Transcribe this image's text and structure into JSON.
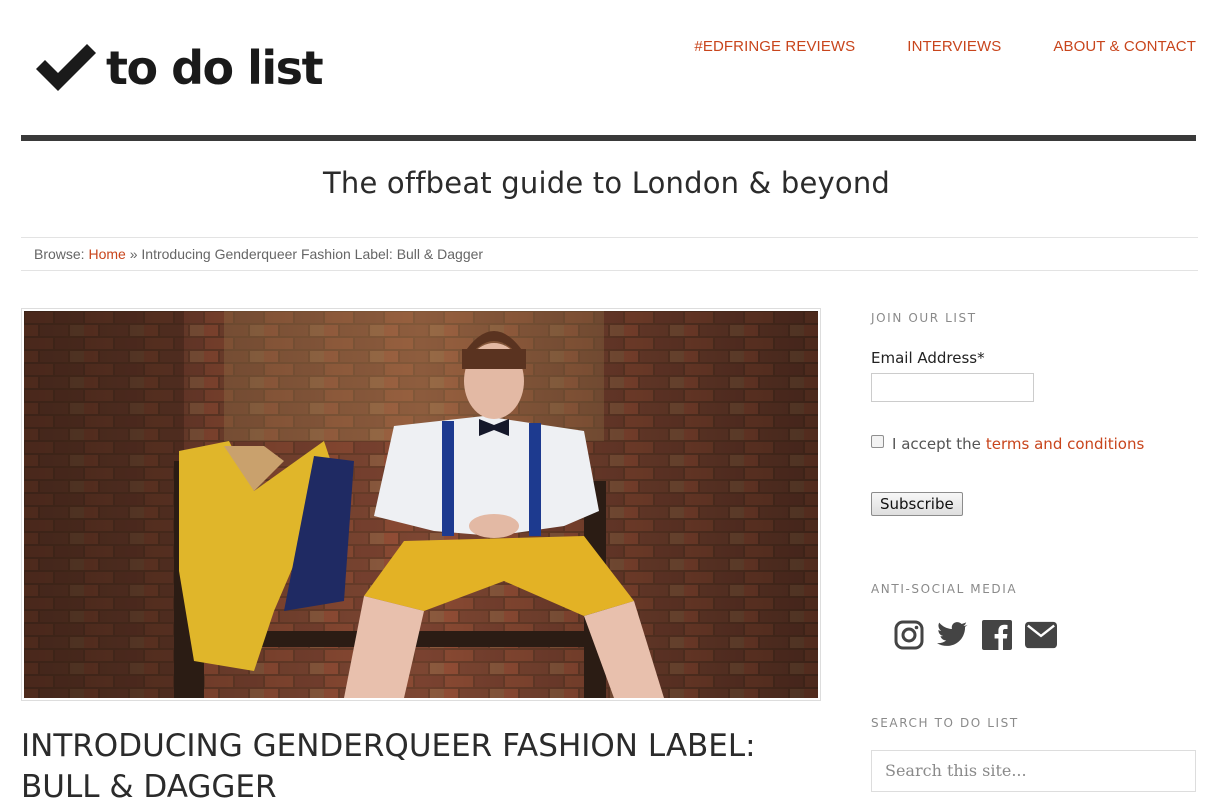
{
  "site": {
    "logo_text": "to do list",
    "tagline": "The offbeat guide to London & beyond"
  },
  "nav": {
    "items": [
      "#EDFRINGE REVIEWS",
      "INTERVIEWS",
      "ABOUT & CONTACT"
    ]
  },
  "breadcrumb": {
    "prefix": "Browse:",
    "home": "Home",
    "separator": "»",
    "current": "Introducing Genderqueer Fashion Label: Bull & Dagger"
  },
  "post": {
    "title_line1": "INTRODUCING GENDERQUEER FASHION LABEL:",
    "title_line2": "BULL & DAGGER"
  },
  "sidebar": {
    "newsletter": {
      "title": "JOIN OUR LIST",
      "email_label": "Email Address*",
      "email_value": "",
      "accept_text": "I accept the",
      "terms_link": "terms and conditions",
      "subscribe_label": "Subscribe",
      "checkbox_checked": false
    },
    "social": {
      "title": "ANTI-SOCIAL MEDIA",
      "icons": [
        "instagram-icon",
        "twitter-icon",
        "facebook-icon",
        "email-icon"
      ]
    },
    "search": {
      "title": "SEARCH TO DO LIST",
      "placeholder": "Search this site..."
    }
  },
  "colors": {
    "accent": "#c8451c",
    "rule": "#3a3a3a",
    "text": "#2b2b2b",
    "icon": "#444444"
  }
}
